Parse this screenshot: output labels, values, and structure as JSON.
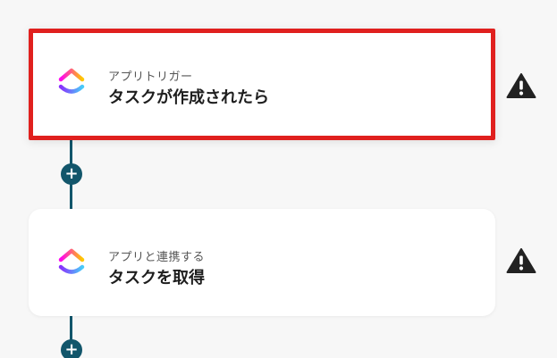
{
  "flow": {
    "steps": [
      {
        "sublabel": "アプリトリガー",
        "title": "タスクが作成されたら",
        "app_icon": "clickup-logo-icon",
        "status_icon": "warning-icon"
      },
      {
        "sublabel": "アプリと連携する",
        "title": "タスクを取得",
        "app_icon": "clickup-logo-icon",
        "status_icon": "warning-icon"
      }
    ],
    "add_step_label": "+"
  },
  "colors": {
    "connector": "#12566b",
    "selection_border": "#e0201e",
    "warning": "#222222",
    "logo_top": "#f78a5a",
    "logo_mid": "#d94bc7",
    "logo_bottom": "#7b68ee"
  }
}
